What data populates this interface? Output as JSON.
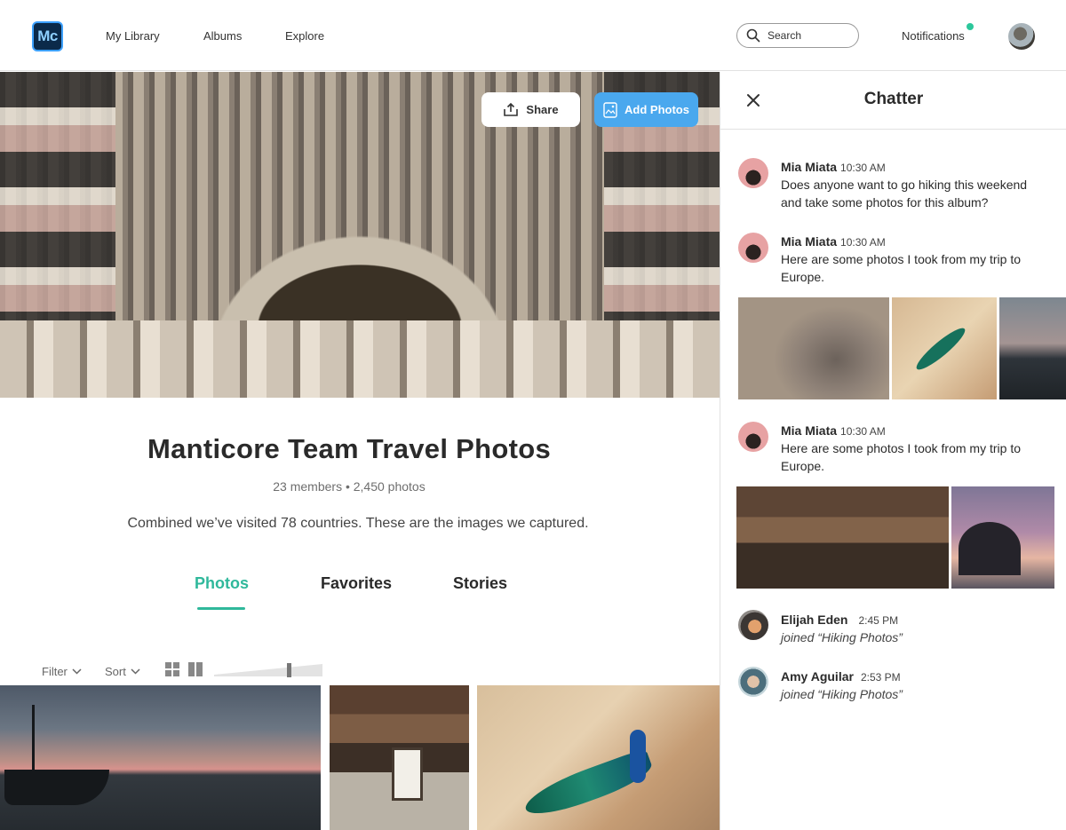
{
  "app": {
    "logo_text": "Mc",
    "brand_color": "#0b2a4a",
    "accent": "#2fb89b",
    "primary_button": "#4aa8ee"
  },
  "nav": {
    "links": [
      "My Library",
      "Albums",
      "Explore"
    ],
    "search_placeholder": "Search",
    "notifications_label": "Notifications",
    "notification_dot_color": "#2cc79b"
  },
  "hero": {
    "share_label": "Share",
    "add_photos_label": "Add Photos"
  },
  "album": {
    "title": "Manticore Team Travel Photos",
    "meta": "23 members • 2,450 photos",
    "description": "Combined we’ve visited 78 countries. These are the images we captured."
  },
  "tabs": [
    {
      "label": "Photos",
      "active": true
    },
    {
      "label": "Favorites",
      "active": false
    },
    {
      "label": "Stories",
      "active": false
    }
  ],
  "toolbar": {
    "filter_label": "Filter",
    "sort_label": "Sort",
    "zoom_level": 0.7
  },
  "photos": [
    "boat-at-sunset",
    "cafe-interior",
    "peacock-on-path"
  ],
  "chatter": {
    "title": "Chatter",
    "messages": [
      {
        "name": "Mia Miata",
        "time": "10:30 AM",
        "text": "Does anyone want to go hiking this weekend and take some photos for this album?"
      },
      {
        "name": "Mia Miata",
        "time": "10:30 AM",
        "text": "Here are some photos I took from my trip to Europe.",
        "photos": [
          "elephant",
          "peacock",
          "boat"
        ]
      },
      {
        "name": "Mia Miata",
        "time": "10:30 AM",
        "text": "Here are some photos I took from my trip to Europe.",
        "photos": [
          "interior",
          "sea-rock-sunset"
        ]
      },
      {
        "name": "Elijah Eden",
        "time": "2:45 PM",
        "text": "joined “Hiking Photos”"
      },
      {
        "name": "Amy Aguilar",
        "time": "2:53 PM",
        "text": "joined “Hiking Photos”"
      }
    ]
  }
}
